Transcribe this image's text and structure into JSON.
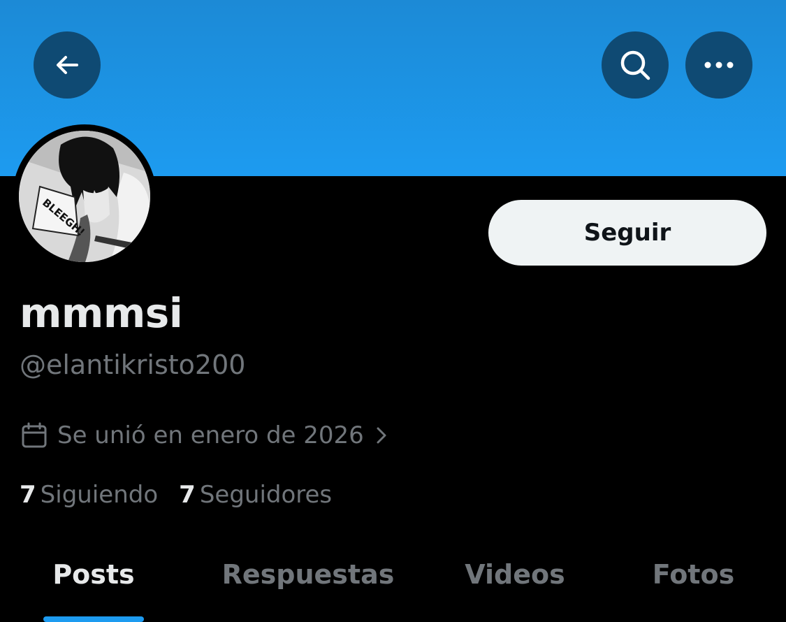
{
  "profile": {
    "display_name": "mmmsi",
    "handle": "@elantikristo200",
    "joined": "Se unió en enero de 2026",
    "follow_label": "Seguir",
    "avatar_text": "BLEEGH!"
  },
  "stats": {
    "following": {
      "count": "7",
      "label": "Siguiendo"
    },
    "followers": {
      "count": "7",
      "label": "Seguidores"
    }
  },
  "tabs": [
    {
      "label": "Posts",
      "active": true
    },
    {
      "label": "Respuestas",
      "active": false
    },
    {
      "label": "Videos",
      "active": false
    },
    {
      "label": "Fotos",
      "active": false
    }
  ],
  "icons": {
    "back": "back-arrow-icon",
    "search": "search-icon",
    "more": "more-options-icon",
    "calendar": "calendar-icon",
    "chevron": "chevron-right-icon"
  },
  "colors": {
    "banner": "#1d9bf0",
    "accent": "#1d9bf0",
    "background": "#000000",
    "secondary_text": "#71767b"
  }
}
